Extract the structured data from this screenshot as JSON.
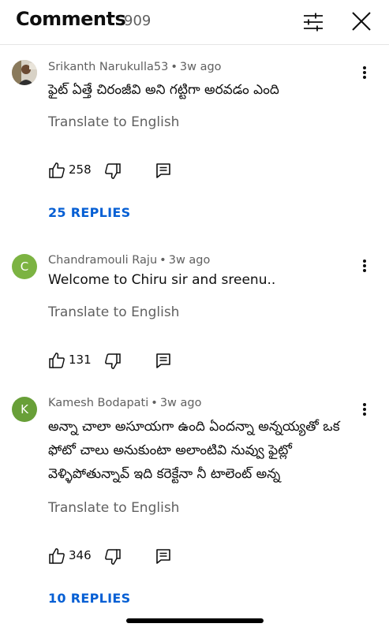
{
  "header": {
    "title": "Comments",
    "count": "909",
    "filter_icon": "sliders-icon",
    "close_icon": "close-icon"
  },
  "comments": [
    {
      "author": "Srikanth Narukulla53",
      "time": "3w ago",
      "text": "ఫైట్ ఏత్తే చిరంజీవి అని గట్టిగా అరవడం ఎంది",
      "translate": "Translate to English",
      "likes": "258",
      "replies": "25 REPLIES",
      "avatar_type": "photo"
    },
    {
      "author": "Chandramouli Raju",
      "time": "3w ago",
      "text": "Welcome to Chiru sir and sreenu..",
      "translate": "Translate to English",
      "likes": "131",
      "avatar_letter": "C",
      "avatar_color": "#7cb342"
    },
    {
      "author": "Kamesh Bodapati",
      "time": "3w ago",
      "text": "అన్నా చాలా అసూయగా ఉంది ఏందన్నా అన్నయ్యతో ఒక ఫోటో చాలు అనుకుంటా అలాంటివి నువ్వు ఫైట్లో వెళ్ళిపోతున్నావ్ ఇది కరెక్టేనా నీ టాలెంట్ అన్న",
      "translate": "Translate to English",
      "likes": "346",
      "replies": "10 REPLIES",
      "avatar_letter": "K",
      "avatar_color": "#689f38"
    }
  ],
  "meta_separator": "•"
}
